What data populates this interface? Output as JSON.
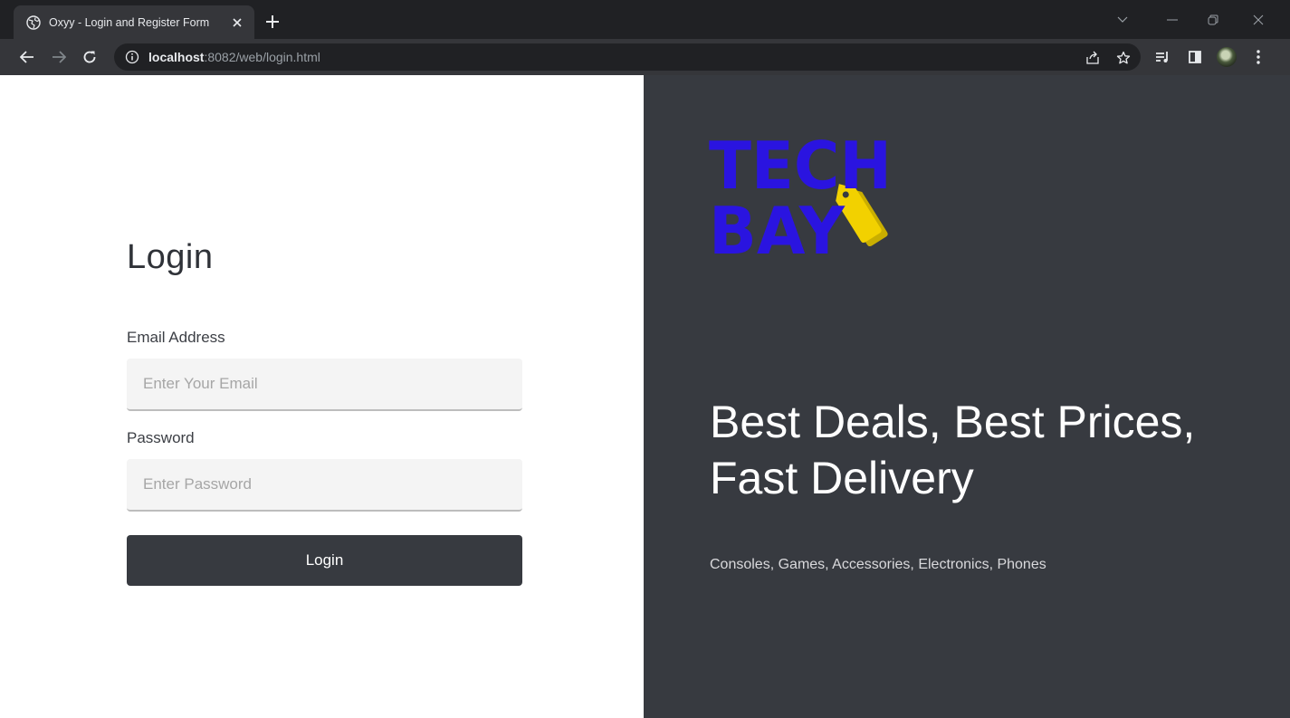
{
  "browser": {
    "tab_title": "Oxyy - Login and Register Form",
    "url_host": "localhost",
    "url_path": ":8082/web/login.html"
  },
  "login_form": {
    "title": "Login",
    "email_label": "Email Address",
    "email_placeholder": "Enter Your Email",
    "email_value": "",
    "password_label": "Password",
    "password_placeholder": "Enter Password",
    "password_value": "",
    "submit_label": "Login"
  },
  "promo": {
    "logo_line1": "TECH",
    "logo_line2": "BAY",
    "headline": "Best Deals, Best Prices, Fast Delivery",
    "tagline": "Consoles, Games, Accessories, Electronics, Phones"
  },
  "colors": {
    "panel_dark": "#373a40",
    "logo_blue": "#2a14e0",
    "logo_yellow": "#f2d100"
  }
}
